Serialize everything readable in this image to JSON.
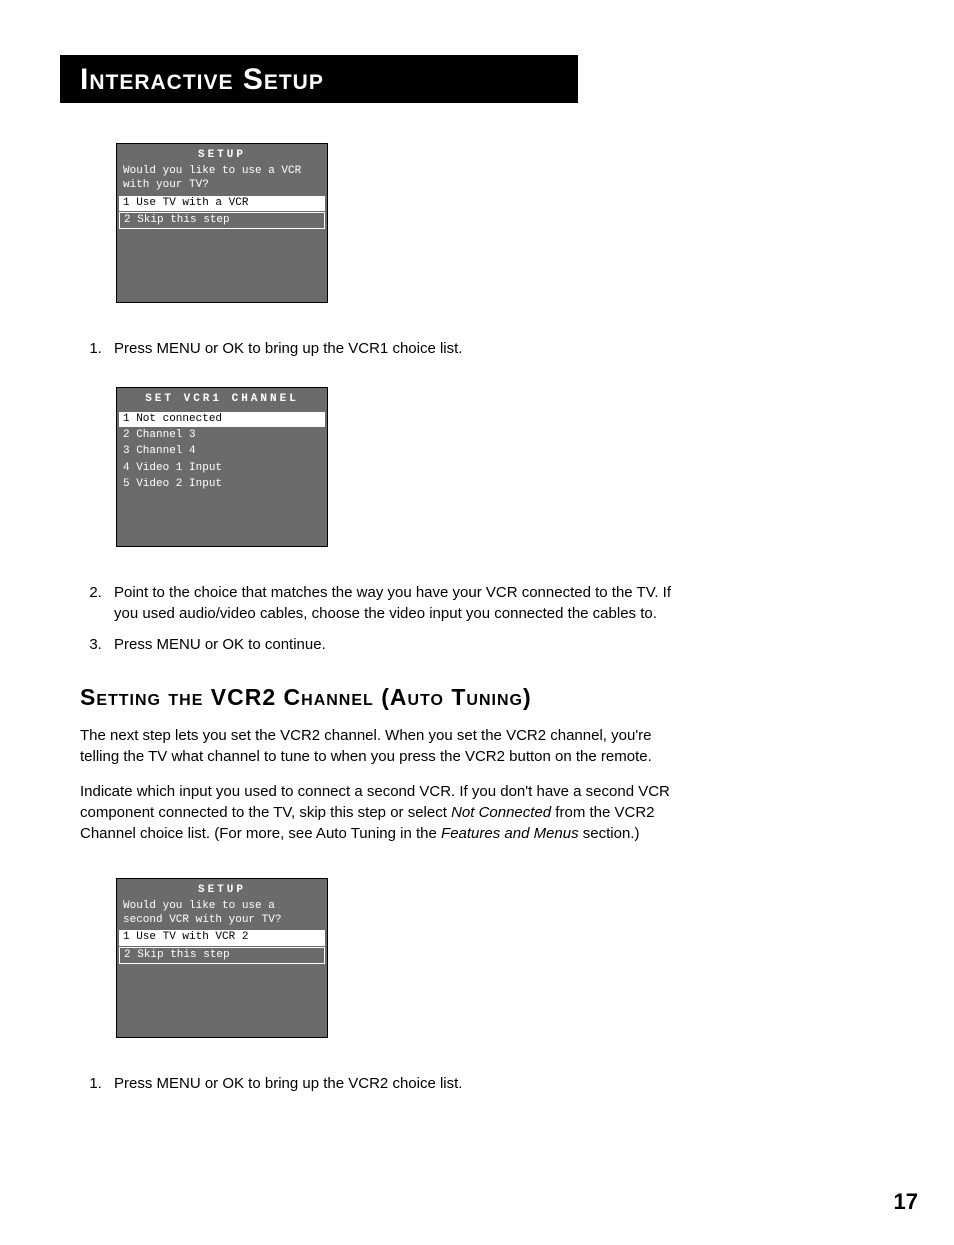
{
  "header": {
    "title": "Interactive Setup"
  },
  "osd1": {
    "title": "SETUP",
    "prompt": "Would you like to use a VCR with your TV?",
    "items": [
      {
        "label": "1 Use TV with a VCR",
        "selected": true
      },
      {
        "label": "2 Skip this step",
        "boxed": true
      }
    ]
  },
  "list1": {
    "item1": "Press MENU or OK to bring up the VCR1 choice list."
  },
  "osd2": {
    "title": "SET VCR1 CHANNEL",
    "items": [
      {
        "label": "1 Not connected",
        "selected": true
      },
      {
        "label": "2 Channel 3"
      },
      {
        "label": "3 Channel 4"
      },
      {
        "label": "4 Video 1 Input"
      },
      {
        "label": "5 Video 2 Input"
      }
    ]
  },
  "list2": {
    "item2": "Point to the choice that matches the way you have your VCR connected to the TV. If you used audio/video cables, choose the video input you connected the cables to.",
    "item3": "Press MENU or OK to continue."
  },
  "section2": {
    "heading": "Setting the VCR2 Channel (Auto Tuning)",
    "p1a": "The next step lets you set the VCR2 channel. When you set the VCR2 channel, you're telling the TV what channel to tune to when you press the VCR2 button on the remote.",
    "p2a": "Indicate which input you used to connect a second VCR.  If you don't have a second VCR component connected to the TV, skip this step or select ",
    "p2b": "Not Connected",
    "p2c": " from the VCR2 Channel choice list. (For more, see Auto Tuning in the ",
    "p2d": "Features and Menus",
    "p2e": " section.)"
  },
  "osd3": {
    "title": "SETUP",
    "prompt": "Would you like to use a second VCR with your TV?",
    "items": [
      {
        "label": "1 Use TV with VCR 2",
        "selected": true
      },
      {
        "label": "2 Skip this step",
        "boxed": true
      }
    ]
  },
  "list3": {
    "item1": "Press MENU or OK to bring up the VCR2 choice list."
  },
  "pagenum": "17"
}
